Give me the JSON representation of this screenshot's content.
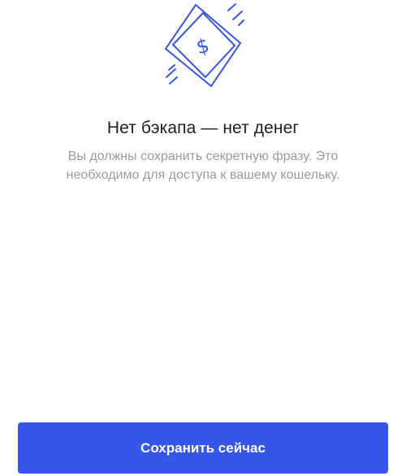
{
  "screen": {
    "title": "Нет бэкапа — нет денег",
    "description": "Вы должны сохранить секретную фразу. Это необходимо для доступа к вашему кошельку."
  },
  "illustration": {
    "icon": "money-bill-icon",
    "glyph": "$",
    "color": "#3656e7"
  },
  "actions": {
    "save_now_label": "Сохранить сейчас",
    "button_color": "#3656e7"
  }
}
